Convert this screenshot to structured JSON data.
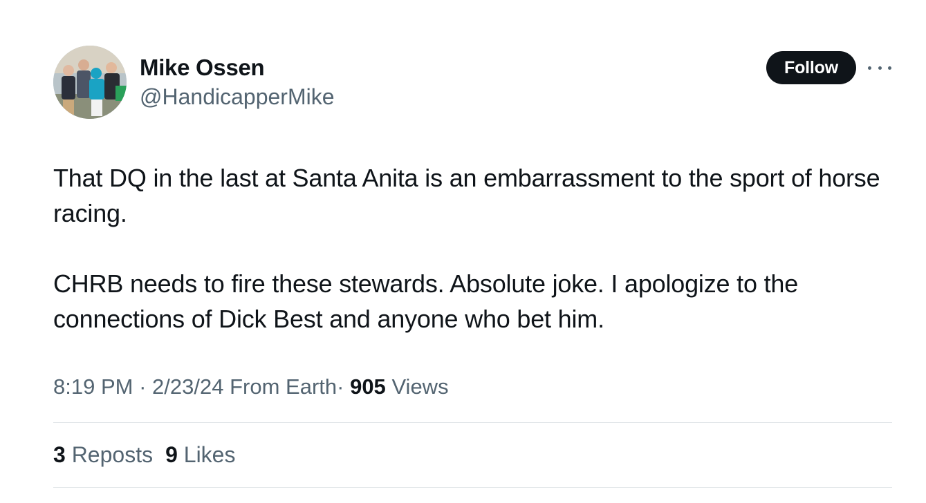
{
  "user": {
    "display_name": "Mike Ossen",
    "handle": "@HandicapperMike"
  },
  "follow_button_label": "Follow",
  "tweet": {
    "paragraphs": [
      "That DQ in the last at Santa Anita is an embarrassment to the sport of horse racing.",
      "CHRB needs to fire these stewards. Absolute joke. I apologize to the connections of Dick Best and anyone who bet him."
    ]
  },
  "meta": {
    "time": "8:19 PM",
    "date": "2/23/24",
    "source": "From Earth",
    "separator": "·",
    "views_count": "905",
    "views_label": "Views"
  },
  "stats": {
    "reposts_count": "3",
    "reposts_label": "Reposts",
    "likes_count": "9",
    "likes_label": "Likes"
  },
  "icons": {
    "more": "more-horizontal-icon"
  },
  "colors": {
    "text_primary": "#0f1419",
    "text_secondary": "#536471",
    "follow_bg": "#0f1419",
    "divider": "#e3e7ea"
  }
}
